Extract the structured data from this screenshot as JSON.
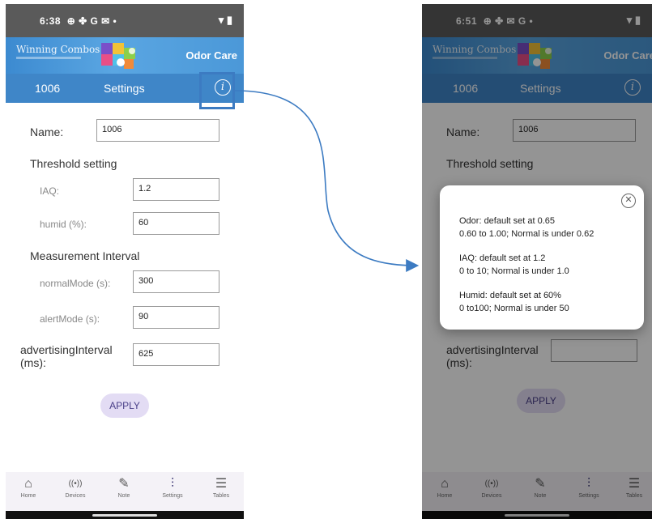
{
  "status_bar": {
    "left": {
      "time": "6:38",
      "icons": "⊕ ✤ G ✉ •"
    },
    "right": {
      "time": "6:51",
      "icons": "⊕ ✤ ✉ G •"
    },
    "system_icons": "▾ ▮"
  },
  "banner": {
    "brand": "Winning Combos",
    "product": "Odor Care"
  },
  "app_bar": {
    "device_name": "1006",
    "tab_title": "Settings",
    "info_glyph": "i"
  },
  "form": {
    "name_label": "Name:",
    "name_value": "1006",
    "threshold_heading": "Threshold setting",
    "iaq_label": "IAQ:",
    "iaq_value": "1.2",
    "humid_label": "humid (%):",
    "humid_value": "60",
    "measurement_heading": "Measurement Interval",
    "normal_label": "normalMode (s):",
    "normal_value": "300",
    "alert_label": "alertMode (s):",
    "alert_value": "90",
    "adv_label_1": "advertisingInterval",
    "adv_label_2": "(ms):",
    "adv_value": "625",
    "apply_label": "APPLY"
  },
  "nav": {
    "items": [
      {
        "label": "Home",
        "icon": "home-icon",
        "glyph": "⌂"
      },
      {
        "label": "Devices",
        "icon": "broadcast-icon",
        "glyph": "((•))"
      },
      {
        "label": "Note",
        "icon": "edit-note-icon",
        "glyph": "✎"
      },
      {
        "label": "Settings",
        "icon": "sliders-icon",
        "glyph": "⫶"
      },
      {
        "label": "Tables",
        "icon": "list-icon",
        "glyph": "☰"
      }
    ]
  },
  "dialog": {
    "close_glyph": "✕",
    "odor_1": "Odor: default set at 0.65",
    "odor_2": "0.60 to 1.00; Normal is under 0.62",
    "iaq_1": "IAQ: default set at 1.2",
    "iaq_2": "0 to 10; Normal is under 1.0",
    "humid_1": "Humid: default set at 60%",
    "humid_2": "0 to100; Normal is under 50"
  },
  "colors": {
    "app_bar": "#3f86c8",
    "highlight": "#3c7bc2",
    "apply_bg": "#e3dcf4",
    "apply_text": "#4a4089"
  }
}
